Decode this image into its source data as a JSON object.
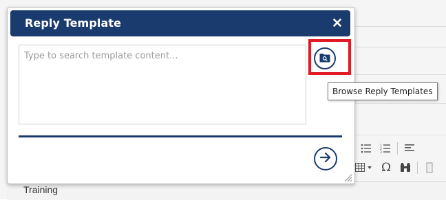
{
  "dialog": {
    "title": "Reply Template",
    "close_icon": "close-icon",
    "search": {
      "placeholder": "Type to search template content...",
      "value": ""
    },
    "browse_button": {
      "icon": "folder-search-icon",
      "tooltip": "Browse Reply Templates"
    },
    "submit_button": {
      "icon": "arrow-right-circle-icon"
    }
  },
  "background": {
    "toolbar_row1": [
      "separator",
      "bullet-list-icon",
      "numbered-list-icon",
      "indent-icon"
    ],
    "toolbar_row2": [
      "table-dropdown-icon",
      "omega-symbol-icon",
      "binoculars-icon",
      "spellcheck-icon"
    ],
    "bottom_label": "Training"
  },
  "colors": {
    "header_bg": "#1a3b6e",
    "accent_highlight": "#e01b24"
  }
}
